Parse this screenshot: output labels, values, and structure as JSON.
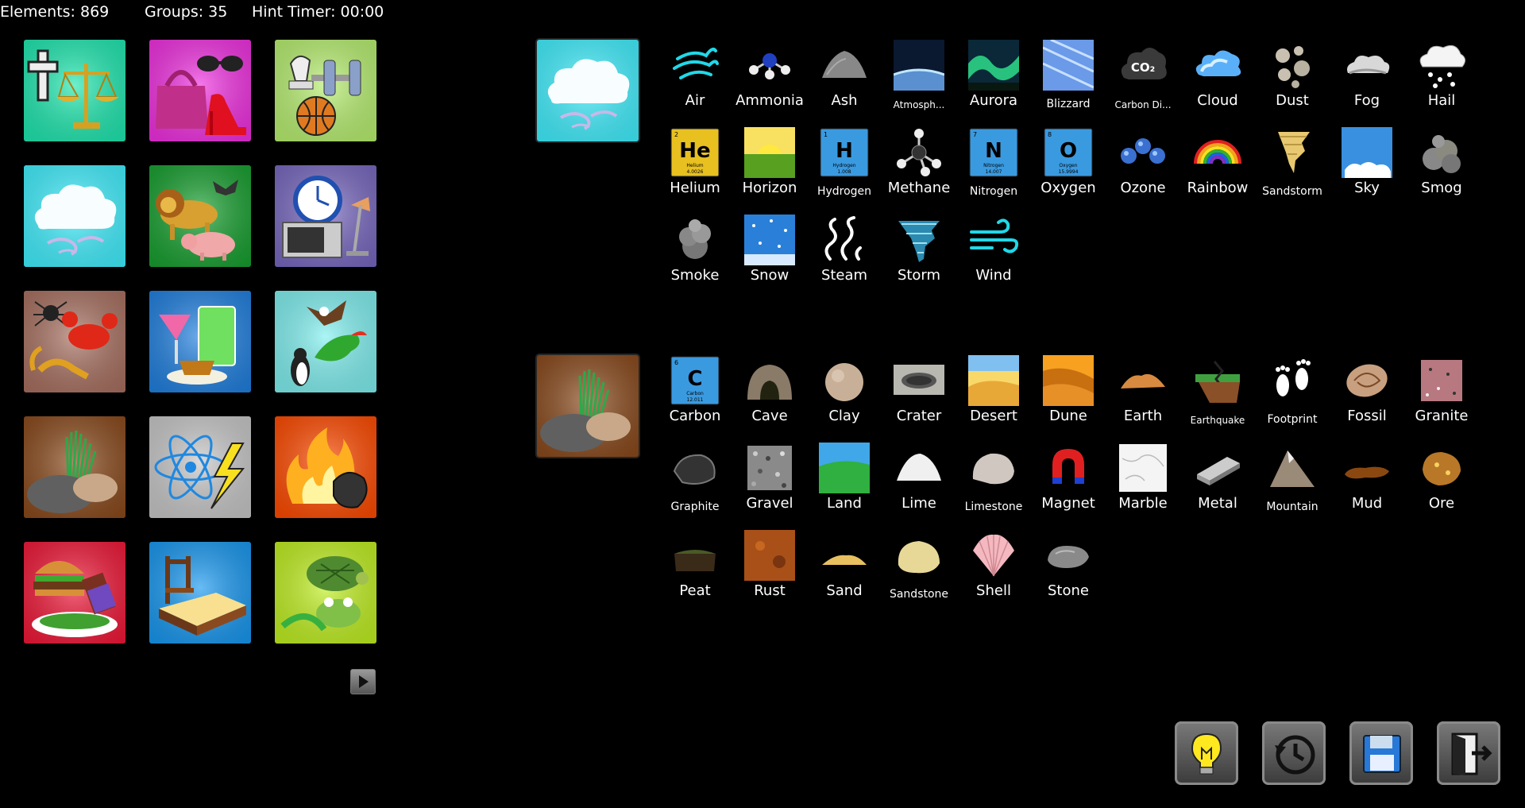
{
  "status": {
    "elements": "Elements: 869",
    "groups": "Groups: 35",
    "hint_timer": "Hint Timer: 00:00"
  },
  "groups": [
    {
      "id": "religion",
      "icon": "cross-scales-icon",
      "color": "#1fe8b0"
    },
    {
      "id": "fashion",
      "icon": "handbag-heels-icon",
      "color": "#f030e0"
    },
    {
      "id": "sports",
      "icon": "chess-dumbbell-ball-icon",
      "color": "#b8f070"
    },
    {
      "id": "air",
      "icon": "cloud-wind-icon",
      "color": "#40f0ff"
    },
    {
      "id": "animals",
      "icon": "lion-pig-bat-icon",
      "color": "#18a030"
    },
    {
      "id": "tools",
      "icon": "clock-microwave-lamp-icon",
      "color": "#7868c0"
    },
    {
      "id": "arthropods",
      "icon": "spider-crab-scorpion-icon",
      "color": "#a87060"
    },
    {
      "id": "drinks",
      "icon": "cocktail-tea-icon",
      "color": "#2080e0"
    },
    {
      "id": "birds",
      "icon": "eagle-parrot-penguin-icon",
      "color": "#80f0f0"
    },
    {
      "id": "earth",
      "icon": "rocks-grass-icon",
      "color": "#8a4a1c"
    },
    {
      "id": "energy",
      "icon": "atom-lightning-icon",
      "color": "#c8c8c8"
    },
    {
      "id": "fire",
      "icon": "fire-coal-icon",
      "color": "#ff4a00"
    },
    {
      "id": "food",
      "icon": "burger-salad-chocolate-icon",
      "color": "#f01838"
    },
    {
      "id": "furniture",
      "icon": "bed-chair-icon",
      "color": "#1898f0"
    },
    {
      "id": "reptiles",
      "icon": "turtle-frog-lizard-icon",
      "color": "#c0f020"
    }
  ],
  "open_groups": [
    {
      "id": "air",
      "icon": "cloud-wind-icon",
      "color": "#40f0ff",
      "elements": [
        {
          "label": "Air",
          "icon": "air-icon"
        },
        {
          "label": "Ammonia",
          "icon": "ammonia-molecule-icon"
        },
        {
          "label": "Ash",
          "icon": "ash-pile-icon"
        },
        {
          "label": "Atmosph...",
          "icon": "atmosphere-icon"
        },
        {
          "label": "Aurora",
          "icon": "aurora-icon"
        },
        {
          "label": "Blizzard",
          "icon": "blizzard-icon"
        },
        {
          "label": "Carbon Di...",
          "icon": "co2-cloud-icon"
        },
        {
          "label": "Cloud",
          "icon": "cloud-icon"
        },
        {
          "label": "Dust",
          "icon": "dust-icon"
        },
        {
          "label": "Fog",
          "icon": "fog-icon"
        },
        {
          "label": "Hail",
          "icon": "hail-icon"
        },
        {
          "label": "Helium",
          "icon": "helium-element-icon"
        },
        {
          "label": "Horizon",
          "icon": "horizon-icon"
        },
        {
          "label": "Hydrogen",
          "icon": "hydrogen-element-icon"
        },
        {
          "label": "Methane",
          "icon": "methane-molecule-icon"
        },
        {
          "label": "Nitrogen",
          "icon": "nitrogen-element-icon"
        },
        {
          "label": "Oxygen",
          "icon": "oxygen-element-icon"
        },
        {
          "label": "Ozone",
          "icon": "ozone-molecule-icon"
        },
        {
          "label": "Rainbow",
          "icon": "rainbow-icon"
        },
        {
          "label": "Sandstorm",
          "icon": "sandstorm-icon"
        },
        {
          "label": "Sky",
          "icon": "sky-icon"
        },
        {
          "label": "Smog",
          "icon": "smog-icon"
        },
        {
          "label": "Smoke",
          "icon": "smoke-icon"
        },
        {
          "label": "Snow",
          "icon": "snow-icon"
        },
        {
          "label": "Steam",
          "icon": "steam-icon"
        },
        {
          "label": "Storm",
          "icon": "tornado-icon"
        },
        {
          "label": "Wind",
          "icon": "wind-icon"
        }
      ]
    },
    {
      "id": "earth",
      "icon": "rocks-grass-icon",
      "color": "#8a4a1c",
      "elements": [
        {
          "label": "Carbon",
          "icon": "carbon-element-icon"
        },
        {
          "label": "Cave",
          "icon": "cave-icon"
        },
        {
          "label": "Clay",
          "icon": "clay-icon"
        },
        {
          "label": "Crater",
          "icon": "crater-icon"
        },
        {
          "label": "Desert",
          "icon": "desert-icon"
        },
        {
          "label": "Dune",
          "icon": "dune-icon"
        },
        {
          "label": "Earth",
          "icon": "earth-pile-icon"
        },
        {
          "label": "Earthquake",
          "icon": "earthquake-icon"
        },
        {
          "label": "Footprint",
          "icon": "footprint-icon"
        },
        {
          "label": "Fossil",
          "icon": "fossil-icon"
        },
        {
          "label": "Granite",
          "icon": "granite-icon"
        },
        {
          "label": "Graphite",
          "icon": "graphite-icon"
        },
        {
          "label": "Gravel",
          "icon": "gravel-icon"
        },
        {
          "label": "Land",
          "icon": "land-icon"
        },
        {
          "label": "Lime",
          "icon": "lime-powder-icon"
        },
        {
          "label": "Limestone",
          "icon": "limestone-icon"
        },
        {
          "label": "Magnet",
          "icon": "magnet-icon"
        },
        {
          "label": "Marble",
          "icon": "marble-icon"
        },
        {
          "label": "Metal",
          "icon": "metal-ingot-icon"
        },
        {
          "label": "Mountain",
          "icon": "mountain-icon"
        },
        {
          "label": "Mud",
          "icon": "mud-icon"
        },
        {
          "label": "Ore",
          "icon": "ore-icon"
        },
        {
          "label": "Peat",
          "icon": "peat-icon"
        },
        {
          "label": "Rust",
          "icon": "rust-icon"
        },
        {
          "label": "Sand",
          "icon": "sand-icon"
        },
        {
          "label": "Sandstone",
          "icon": "sandstone-icon"
        },
        {
          "label": "Shell",
          "icon": "shell-icon"
        },
        {
          "label": "Stone",
          "icon": "stone-icon"
        }
      ]
    }
  ],
  "toolbar": [
    {
      "id": "hint",
      "icon": "lightbulb-icon"
    },
    {
      "id": "history",
      "icon": "history-clock-icon"
    },
    {
      "id": "save",
      "icon": "floppy-disk-icon"
    },
    {
      "id": "exit",
      "icon": "exit-door-icon"
    }
  ],
  "next_page_icon": "play-arrow-icon"
}
